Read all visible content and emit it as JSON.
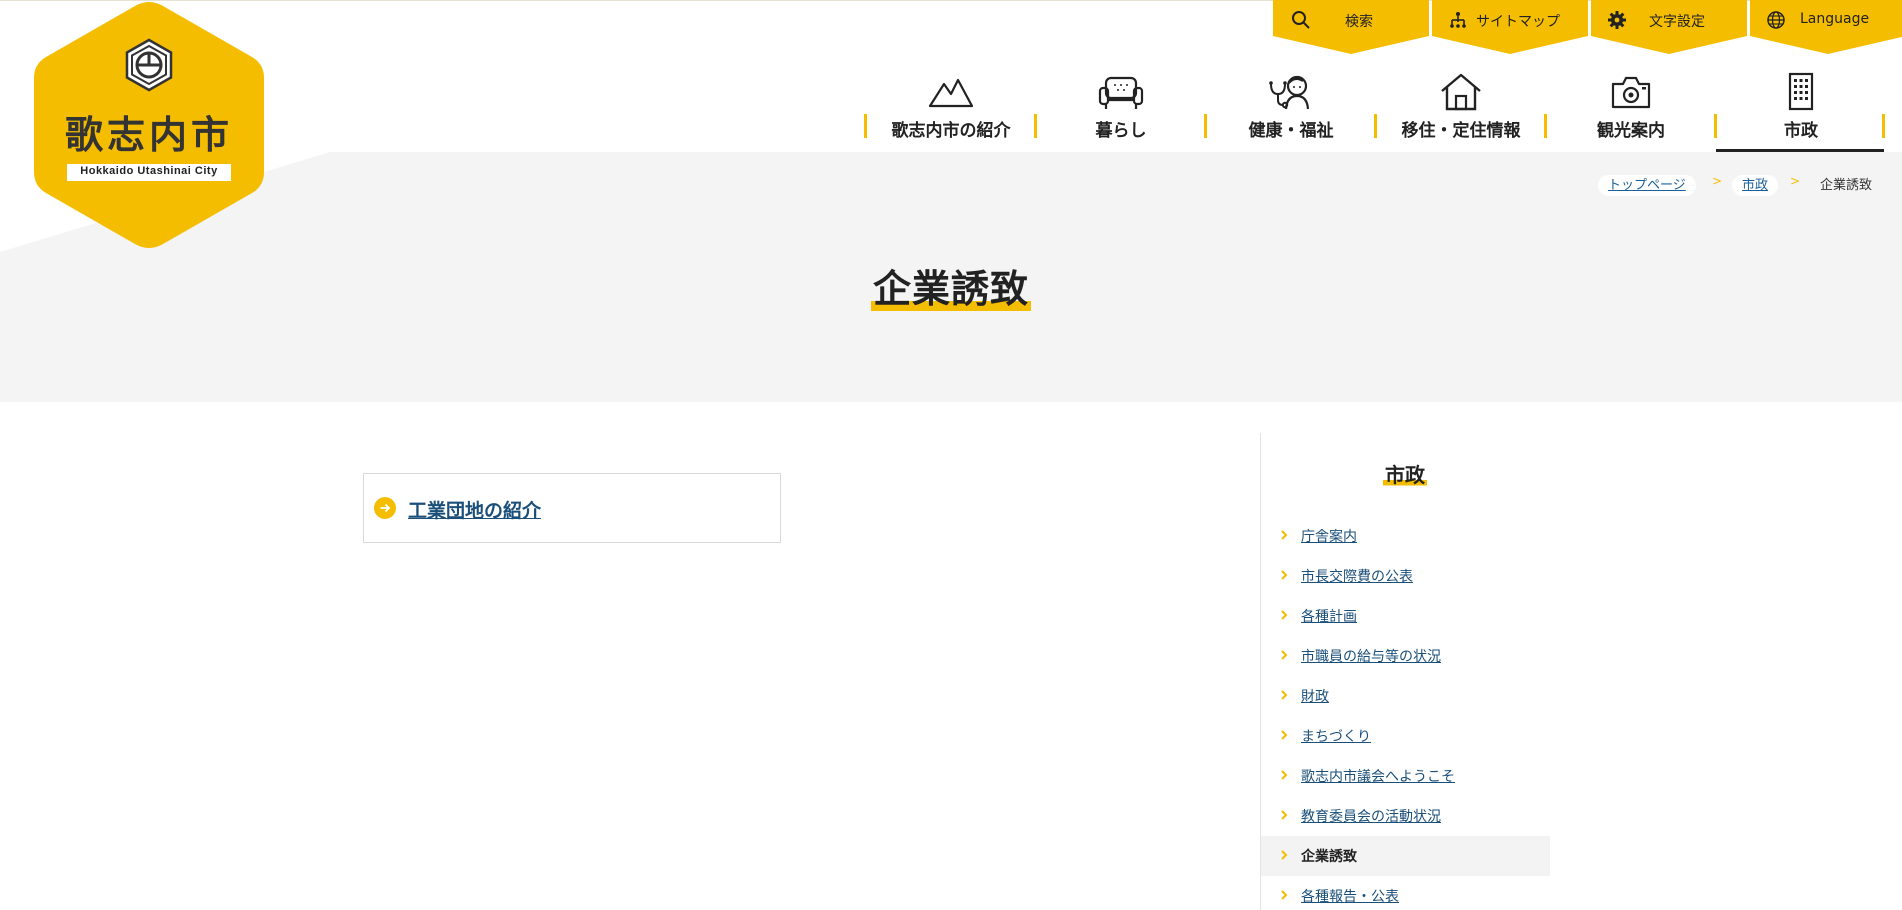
{
  "logo": {
    "name": "歌志内市",
    "subtitle": "Hokkaido Utashinai City"
  },
  "utility_nav": [
    {
      "label": "検索",
      "icon": "search-icon"
    },
    {
      "label": "サイトマップ",
      "icon": "sitemap-icon"
    },
    {
      "label": "文字設定",
      "icon": "gear-icon"
    },
    {
      "label": "Language",
      "icon": "globe-icon"
    }
  ],
  "main_nav": [
    {
      "label": "歌志内市の紹介",
      "icon": "mountain-icon"
    },
    {
      "label": "暮らし",
      "icon": "sofa-icon"
    },
    {
      "label": "健康・福祉",
      "icon": "stethoscope-child-icon"
    },
    {
      "label": "移住・定住情報",
      "icon": "house-icon"
    },
    {
      "label": "観光案内",
      "icon": "camera-icon"
    },
    {
      "label": "市政",
      "icon": "building-icon",
      "active": true
    }
  ],
  "breadcrumb": {
    "items": [
      "トップページ",
      "市政"
    ],
    "separator": ">",
    "current": "企業誘致"
  },
  "page": {
    "title": "企業誘致"
  },
  "content": {
    "links": [
      {
        "label": "工業団地の紹介",
        "icon": "arrow-circle-icon"
      }
    ]
  },
  "sidebar": {
    "title": "市政",
    "items": [
      {
        "label": "庁舎案内"
      },
      {
        "label": "市長交際費の公表"
      },
      {
        "label": "各種計画"
      },
      {
        "label": "市職員の給与等の状況"
      },
      {
        "label": "財政"
      },
      {
        "label": "まちづくり"
      },
      {
        "label": "歌志内市議会へようこそ"
      },
      {
        "label": "教育委員会の活動状況"
      },
      {
        "label": "企業誘致",
        "active": true
      },
      {
        "label": "各種報告・公表"
      }
    ]
  },
  "colors": {
    "accent": "#f5bd00",
    "link": "#1a4f7a",
    "banner_bg": "#f3f4f3",
    "text": "#222222"
  }
}
